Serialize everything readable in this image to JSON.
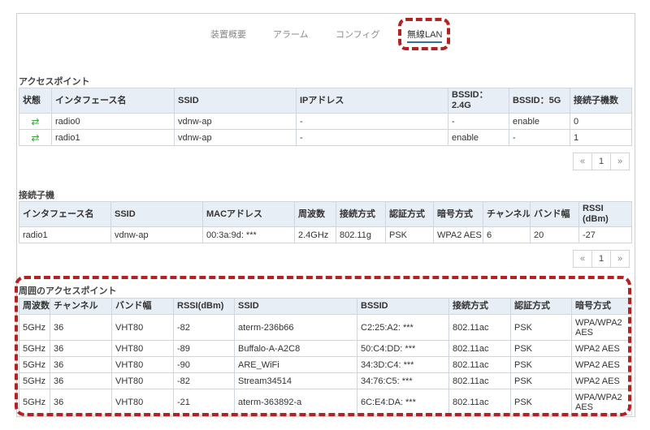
{
  "tabs": [
    "装置概要",
    "アラーム",
    "コンフィグ",
    "無線LAN"
  ],
  "ap_section": {
    "title": "アクセスポイント",
    "headers": [
      "状態",
      "インタフェース名",
      "SSID",
      "IPアドレス",
      "BSSID：2.4G",
      "BSSID：5G",
      "接続子機数"
    ],
    "rows": [
      {
        "status": "⇄",
        "iface": "radio0",
        "ssid": "vdnw-ap",
        "ip": "-",
        "b24": "-",
        "b5": "enable",
        "count": "0"
      },
      {
        "status": "⇄",
        "iface": "radio1",
        "ssid": "vdnw-ap",
        "ip": "-",
        "b24": "enable",
        "b5": "-",
        "count": "1"
      }
    ],
    "pager": {
      "prev": "«",
      "page": "1",
      "next": "»"
    }
  },
  "client_section": {
    "title": "接続子機",
    "headers": [
      "インタフェース名",
      "SSID",
      "MACアドレス",
      "周波数",
      "接続方式",
      "認証方式",
      "暗号方式",
      "チャンネル",
      "バンド幅",
      "RSSI (dBm)"
    ],
    "rows": [
      {
        "iface": "radio1",
        "ssid": "vdnw-ap",
        "mac": "00:3a:9d: ***",
        "freq": "2.4GHz",
        "mode": "802.11g",
        "auth": "PSK",
        "enc": "WPA2 AES",
        "ch": "6",
        "bw": "20",
        "rssi": "-27"
      }
    ],
    "pager": {
      "prev": "«",
      "page": "1",
      "next": "»"
    }
  },
  "neighbor_section": {
    "title": "周囲のアクセスポイント",
    "headers": [
      "周波数",
      "チャンネル",
      "バンド幅",
      "RSSI(dBm)",
      "SSID",
      "BSSID",
      "接続方式",
      "認証方式",
      "暗号方式"
    ],
    "rows": [
      {
        "freq": "5GHz",
        "ch": "36",
        "bw": "VHT80",
        "rssi": "-82",
        "ssid": "aterm-236b66",
        "bssid": "C2:25:A2: ***",
        "mode": "802.11ac",
        "auth": "PSK",
        "enc": "WPA/WPA2 AES"
      },
      {
        "freq": "5GHz",
        "ch": "36",
        "bw": "VHT80",
        "rssi": "-89",
        "ssid": "Buffalo-A-A2C8",
        "bssid": "50:C4:DD: ***",
        "mode": "802.11ac",
        "auth": "PSK",
        "enc": "WPA2 AES"
      },
      {
        "freq": "5GHz",
        "ch": "36",
        "bw": "VHT80",
        "rssi": "-90",
        "ssid": "ARE_WiFi",
        "bssid": "34:3D:C4: ***",
        "mode": "802.11ac",
        "auth": "PSK",
        "enc": "WPA2 AES"
      },
      {
        "freq": "5GHz",
        "ch": "36",
        "bw": "VHT80",
        "rssi": "-82",
        "ssid": "Stream34514",
        "bssid": "34:76:C5: ***",
        "mode": "802.11ac",
        "auth": "PSK",
        "enc": "WPA2 AES"
      },
      {
        "freq": "5GHz",
        "ch": "36",
        "bw": "VHT80",
        "rssi": "-21",
        "ssid": "aterm-363892-a",
        "bssid": "6C:E4:DA: ***",
        "mode": "802.11ac",
        "auth": "PSK",
        "enc": "WPA/WPA2 AES"
      }
    ]
  }
}
